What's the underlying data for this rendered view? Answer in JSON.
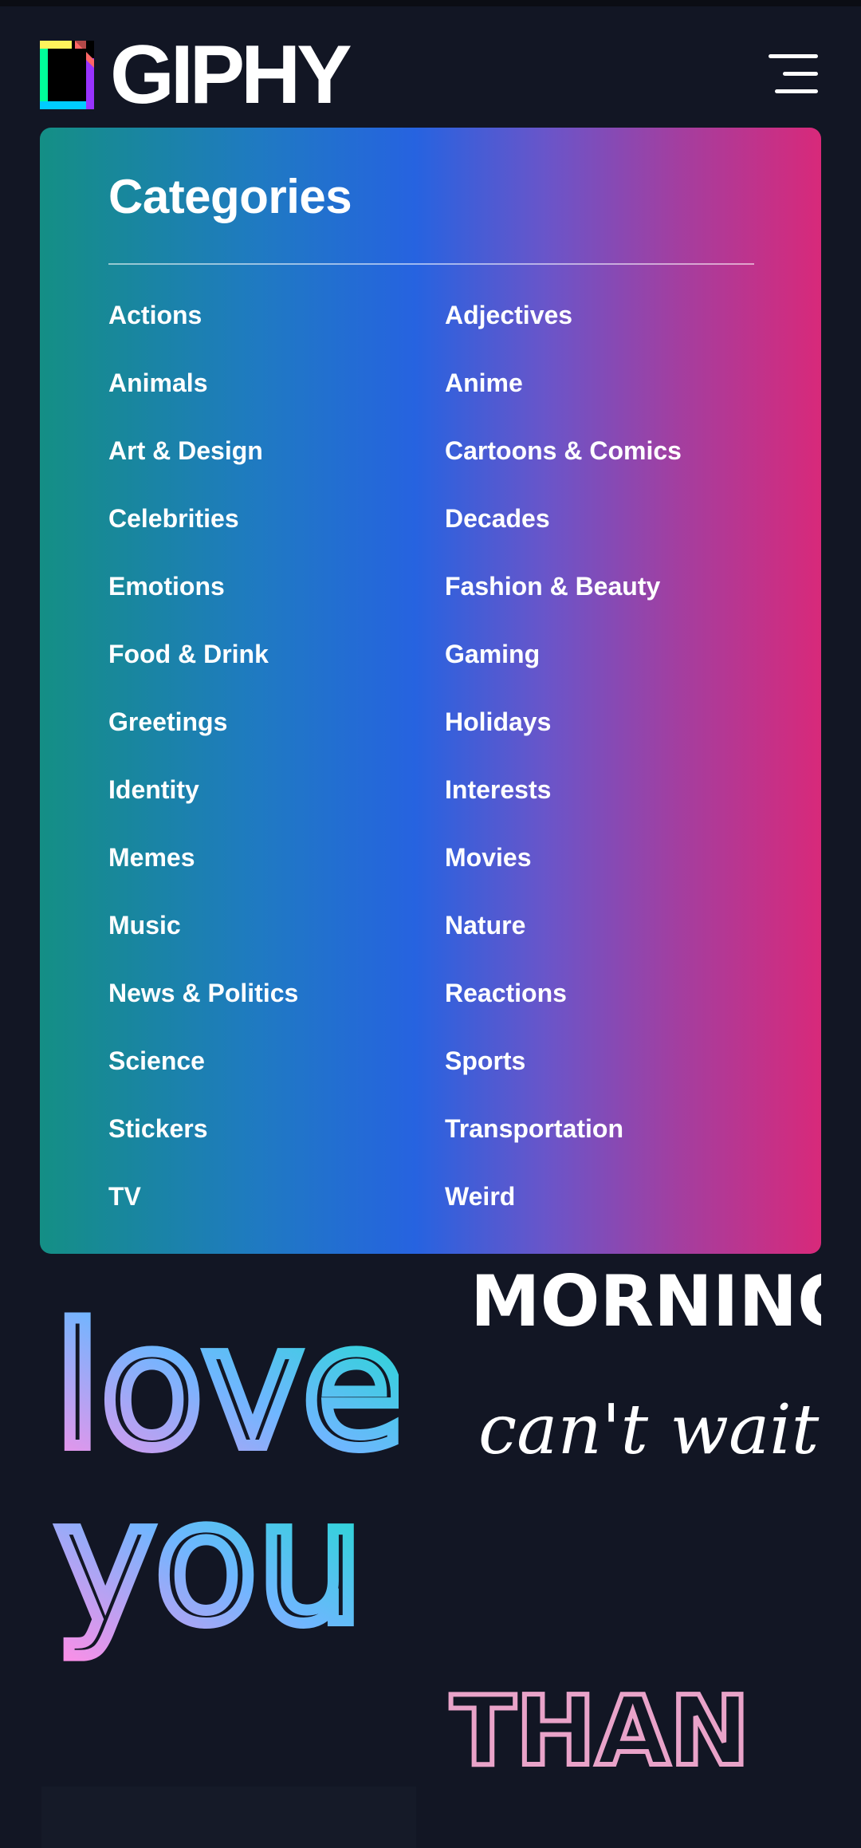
{
  "header": {
    "brand": "GIPHY",
    "logo_colors": [
      "#00ff99",
      "#00ccff",
      "#9933ff",
      "#ff6666",
      "#fff35c"
    ]
  },
  "panel": {
    "title": "Categories",
    "gradient": [
      "#148f85",
      "#2663e0",
      "#d8297a"
    ],
    "categories": [
      "Actions",
      "Adjectives",
      "Animals",
      "Anime",
      "Art & Design",
      "Cartoons & Comics",
      "Celebrities",
      "Decades",
      "Emotions",
      "Fashion & Beauty",
      "Food & Drink",
      "Gaming",
      "Greetings",
      "Holidays",
      "Identity",
      "Interests",
      "Memes",
      "Movies",
      "Music",
      "Nature",
      "News & Politics",
      "Reactions",
      "Science",
      "Sports",
      "Stickers",
      "Transportation",
      "TV",
      "Weird"
    ]
  },
  "gifs": {
    "love_you": [
      "love",
      "you"
    ],
    "morning": "MORNING",
    "cant_wait": "can't wait!",
    "than": "THAN"
  }
}
